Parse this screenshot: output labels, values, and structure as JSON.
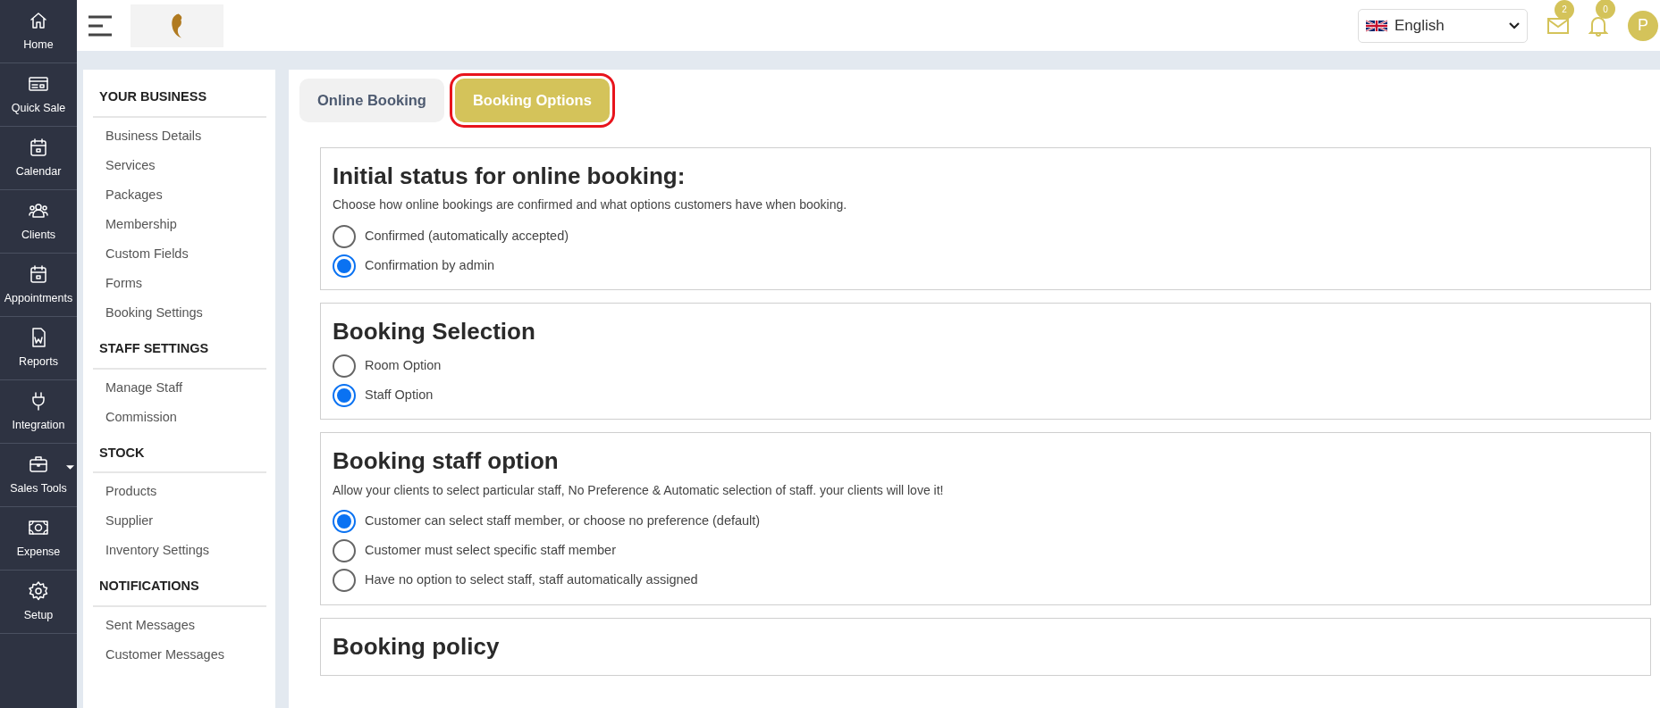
{
  "sidebar": {
    "items": [
      {
        "label": "Home",
        "dropdown": false
      },
      {
        "label": "Quick Sale",
        "dropdown": false
      },
      {
        "label": "Calendar",
        "dropdown": false
      },
      {
        "label": "Clients",
        "dropdown": false
      },
      {
        "label": "Appointments",
        "dropdown": false
      },
      {
        "label": "Reports",
        "dropdown": false
      },
      {
        "label": "Integration",
        "dropdown": false
      },
      {
        "label": "Sales Tools",
        "dropdown": true
      },
      {
        "label": "Expense",
        "dropdown": false
      },
      {
        "label": "Setup",
        "dropdown": false
      }
    ]
  },
  "topbar": {
    "language": "English",
    "messages_count": "2",
    "notifications_count": "0",
    "avatar_initial": "P"
  },
  "settings_nav": {
    "sections": [
      {
        "heading": "YOUR BUSINESS",
        "items": [
          "Business Details",
          "Services",
          "Packages",
          "Membership",
          "Custom Fields",
          "Forms",
          "Booking Settings"
        ]
      },
      {
        "heading": "STAFF SETTINGS",
        "items": [
          "Manage Staff",
          "Commission"
        ]
      },
      {
        "heading": "STOCK",
        "items": [
          "Products",
          "Supplier",
          "Inventory Settings"
        ]
      },
      {
        "heading": "NOTIFICATIONS",
        "items": [
          "Sent Messages",
          "Customer Messages"
        ]
      }
    ]
  },
  "tabs": [
    {
      "label": "Online Booking",
      "selected": false,
      "outlined": false
    },
    {
      "label": "Booking Options",
      "selected": true,
      "outlined": true
    }
  ],
  "sections": [
    {
      "title": "Initial status for online booking:",
      "description": "Choose how online bookings are confirmed and what options customers have when booking.",
      "options": [
        {
          "label": "Confirmed (automatically accepted)",
          "selected": false
        },
        {
          "label": "Confirmation by admin",
          "selected": true
        }
      ]
    },
    {
      "title": "Booking Selection",
      "options": [
        {
          "label": "Room Option",
          "selected": false
        },
        {
          "label": "Staff Option",
          "selected": true
        }
      ]
    },
    {
      "title": "Booking staff option",
      "description": "Allow your clients to select particular staff, No Preference & Automatic selection of staff. your clients will love it!",
      "options": [
        {
          "label": "Customer can select staff member, or choose no preference (default)",
          "selected": true
        },
        {
          "label": "Customer must select specific staff member",
          "selected": false
        },
        {
          "label": "Have no option to select staff, staff automatically assigned",
          "selected": false
        }
      ]
    },
    {
      "title": "Booking policy"
    }
  ]
}
